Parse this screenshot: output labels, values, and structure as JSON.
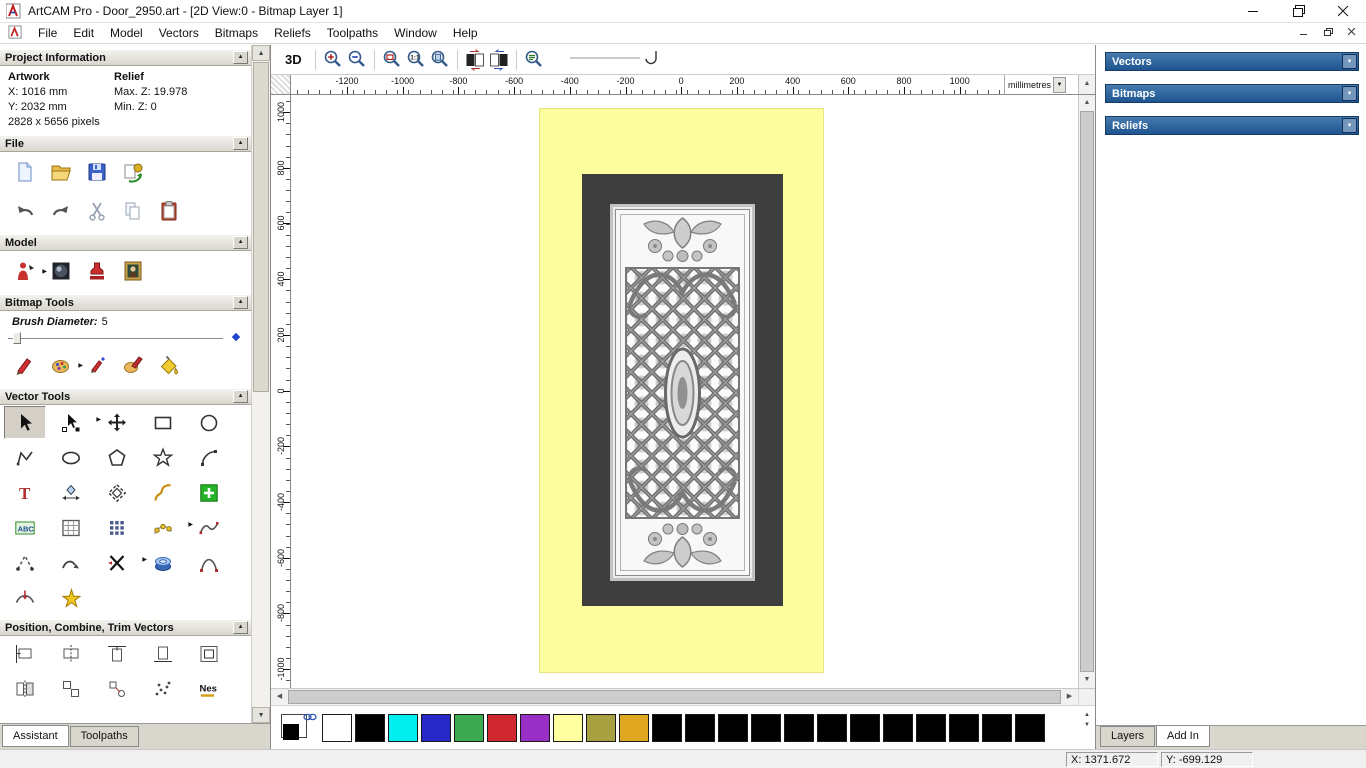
{
  "window": {
    "title": "ArtCAM Pro - Door_2950.art - [2D View:0 - Bitmap Layer 1]"
  },
  "menu": {
    "items": [
      "File",
      "Edit",
      "Model",
      "Vectors",
      "Bitmaps",
      "Reliefs",
      "Toolpaths",
      "Window",
      "Help"
    ]
  },
  "assistant": {
    "project_information": {
      "title": "Project Information",
      "artwork_label": "Artwork",
      "relief_label": "Relief",
      "x": "X: 1016 mm",
      "y": "Y: 2032 mm",
      "max_z": "Max. Z: 19.978",
      "min_z": "Min. Z: 0",
      "pixels": "2828 x 5656 pixels"
    },
    "file": {
      "title": "File",
      "row1": [
        {
          "name": "new-model-icon"
        },
        {
          "name": "open-model-icon"
        },
        {
          "name": "save-model-icon"
        },
        {
          "name": "import-export-icon"
        }
      ],
      "row2": [
        {
          "name": "undo-icon"
        },
        {
          "name": "redo-icon"
        },
        {
          "name": "cut-icon"
        },
        {
          "name": "copy-icon"
        },
        {
          "name": "paste-icon"
        }
      ]
    },
    "model": {
      "title": "Model",
      "icons": [
        {
          "name": "set-model-size-icon",
          "flyout": true
        },
        {
          "name": "lighting-material-icon"
        },
        {
          "name": "notes-stamp-icon"
        },
        {
          "name": "load-relief-texture-icon"
        }
      ]
    },
    "bitmap_tools": {
      "title": "Bitmap Tools",
      "brush_label": "Brush Diameter:",
      "brush_value": "5",
      "icons": [
        {
          "name": "paint-icon"
        },
        {
          "name": "paint-selective-icon",
          "flyout": true
        },
        {
          "name": "draw-icon"
        },
        {
          "name": "colour-picker-icon"
        },
        {
          "name": "flood-fill-icon"
        }
      ]
    },
    "vector_tools": {
      "title": "Vector Tools",
      "rows": [
        [
          {
            "name": "select-vectors-icon",
            "pressed": true
          },
          {
            "name": "node-editing-icon",
            "flyout": true
          },
          {
            "name": "transform-vectors-icon"
          },
          {
            "name": "rectangle-tool-icon"
          },
          {
            "name": "circle-tool-icon"
          }
        ],
        [
          {
            "name": "polyline-tool-icon"
          },
          {
            "name": "ellipse-tool-icon"
          },
          {
            "name": "polygon-tool-icon"
          },
          {
            "name": "star-tool-icon"
          },
          {
            "name": "arc-tool-icon"
          }
        ],
        [
          {
            "name": "text-tool-icon"
          },
          {
            "name": "measure-tool-icon"
          },
          {
            "name": "offset-vector-icon"
          },
          {
            "name": "fillet-tool-icon"
          },
          {
            "name": "paste-replace-icon"
          }
        ],
        [
          {
            "name": "text-on-curve-icon"
          },
          {
            "name": "envelope-distort-icon"
          },
          {
            "name": "block-copy-icon"
          },
          {
            "name": "paste-along-curve-icon",
            "flyout": true
          },
          {
            "name": "smooth-polyline-icon"
          }
        ],
        [
          {
            "name": "close-vector-icon"
          },
          {
            "name": "join-vectors-icon"
          },
          {
            "name": "trim-vectors-icon",
            "flyout": true
          },
          {
            "name": "create-swept-icon"
          },
          {
            "name": "fit-arcs-icon"
          }
        ],
        [
          {
            "name": "section-profile-icon"
          },
          {
            "name": "vector-doctor-icon"
          }
        ]
      ]
    },
    "position_tools": {
      "title": "Position, Combine, Trim Vectors",
      "rows": [
        [
          {
            "name": "align-left-icon"
          },
          {
            "name": "align-centre-icon"
          },
          {
            "name": "align-top-icon"
          },
          {
            "name": "align-bottom-icon"
          },
          {
            "name": "align-contour-icon"
          }
        ],
        [
          {
            "name": "mirror-icon"
          },
          {
            "name": "block-icon"
          },
          {
            "name": "snap-icon"
          },
          {
            "name": "scatter-icon"
          },
          {
            "name": "nesting-icon",
            "label": "Nes"
          }
        ]
      ]
    },
    "tabs": [
      {
        "label": "Assistant",
        "active": true
      },
      {
        "label": "Toolpaths",
        "active": false
      }
    ]
  },
  "canvas": {
    "toolbar": {
      "view_3d_label": "3D",
      "groups": [
        [
          "zoom-in-icon",
          "zoom-out-icon"
        ],
        [
          "zoom-box-icon",
          "zoom-1to1-icon",
          "zoom-page-icon"
        ],
        [
          "toggle-bitmap-view-icon",
          "toggle-vector-view-icon"
        ],
        [
          "zoom-objects-icon"
        ]
      ]
    },
    "h_ruler": {
      "labels": [
        "-1200",
        "-1000",
        "-800",
        "-600",
        "-400",
        "-200",
        "0",
        "200",
        "400",
        "600",
        "800",
        "1000"
      ],
      "units": "millimetres"
    },
    "v_ruler": {
      "labels": [
        "1000",
        "800",
        "600",
        "400",
        "200",
        "0",
        "-200",
        "-400",
        "-600",
        "-800",
        "-1000"
      ]
    }
  },
  "right_panel": {
    "sections": [
      {
        "title": "Vectors"
      },
      {
        "title": "Bitmaps"
      },
      {
        "title": "Reliefs"
      }
    ],
    "tabs": [
      {
        "label": "Layers",
        "active": false
      },
      {
        "label": "Add In",
        "active": true
      }
    ]
  },
  "palette": {
    "colors": [
      "#ffffff",
      "#000000",
      "#00eeee",
      "#2828c8",
      "#3caa50",
      "#d02830",
      "#9830c8",
      "#ffffa0",
      "#a8a040",
      "#e0a820",
      "#000000",
      "#000000",
      "#000000",
      "#000000",
      "#000000",
      "#000000",
      "#000000",
      "#000000",
      "#000000",
      "#000000",
      "#000000",
      "#000000"
    ]
  },
  "status": {
    "x_label": "X: 1371.672",
    "y_label": "Y: -699.129"
  }
}
